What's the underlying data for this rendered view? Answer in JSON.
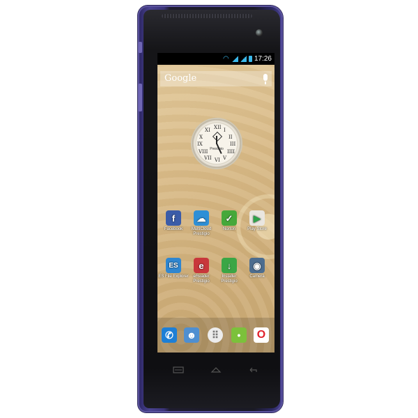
{
  "status_bar": {
    "time": "17:26"
  },
  "search": {
    "brand": "Google"
  },
  "clock": {
    "brand": "Prestigio",
    "numerals": [
      "XII",
      "I",
      "II",
      "III",
      "IIII",
      "V",
      "VI",
      "VII",
      "VIII",
      "IX",
      "X",
      "XI"
    ]
  },
  "apps": [
    {
      "label": "Facebook",
      "icon": "facebook-icon",
      "color": "#3b5ca8",
      "glyph": "f"
    },
    {
      "label": "MultiCloud Prestigio",
      "icon": "cloud-shield-icon",
      "color": "#2e8fd6",
      "glyph": "☁"
    },
    {
      "label": "Norton",
      "icon": "norton-shield-icon",
      "color": "#46a83a",
      "glyph": "✓"
    },
    {
      "label": "Play Store",
      "icon": "play-store-icon",
      "color": "#e9e6e0",
      "glyph": "▶"
    },
    {
      "label": "ES File Explorer",
      "icon": "es-file-explorer-icon",
      "color": "#2f86d0",
      "glyph": "ES"
    },
    {
      "label": "eReader Prestigio",
      "icon": "ereader-icon",
      "color": "#c8373b",
      "glyph": "e"
    },
    {
      "label": "Installer Prestigio",
      "icon": "installer-icon",
      "color": "#3aa645",
      "glyph": "↓"
    },
    {
      "label": "Camera",
      "icon": "camera-icon",
      "color": "#4d6d8f",
      "glyph": "◉"
    }
  ],
  "dock": [
    {
      "icon": "phone-icon",
      "color": "#1d7fd6",
      "glyph": "✆"
    },
    {
      "icon": "contacts-icon",
      "color": "#4f8fd1",
      "glyph": "☻"
    },
    {
      "icon": "all-apps-icon",
      "color": "#ececec",
      "glyph": "⠿"
    },
    {
      "icon": "messaging-icon",
      "color": "#7cc13b",
      "glyph": "•"
    },
    {
      "icon": "opera-icon",
      "color": "#ffffff",
      "glyph": "O"
    }
  ],
  "colors": {
    "body_accent": "#4a4390",
    "status_icon": "#3bb8ea"
  }
}
